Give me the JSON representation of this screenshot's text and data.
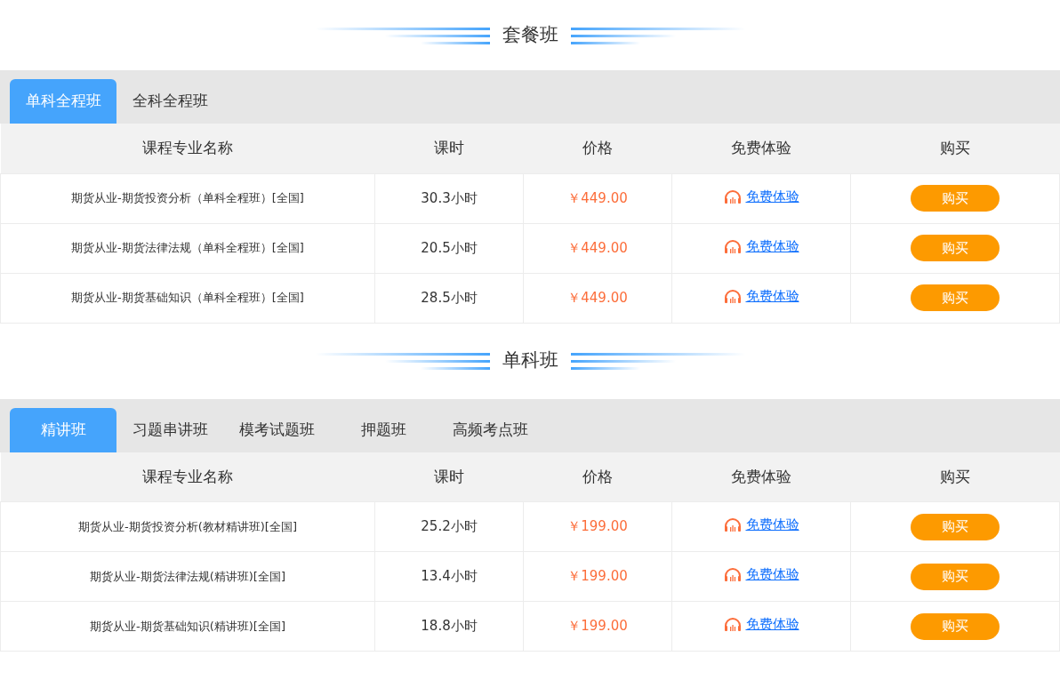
{
  "sections": [
    {
      "title": "套餐班",
      "tabs": [
        {
          "label": "单科全程班",
          "selected": true
        },
        {
          "label": "全科全程班",
          "selected": false
        }
      ],
      "columns": [
        "课程专业名称",
        "课时",
        "价格",
        "免费体验",
        "购买"
      ],
      "rows": [
        {
          "name": "期货从业-期货投资分析（单科全程班）[全国]",
          "hours": "30.3小时",
          "price": "￥449.00",
          "trial": "免费体验",
          "buy": "购买"
        },
        {
          "name": "期货从业-期货法律法规（单科全程班）[全国]",
          "hours": "20.5小时",
          "price": "￥449.00",
          "trial": "免费体验",
          "buy": "购买"
        },
        {
          "name": "期货从业-期货基础知识（单科全程班）[全国]",
          "hours": "28.5小时",
          "price": "￥449.00",
          "trial": "免费体验",
          "buy": "购买"
        }
      ]
    },
    {
      "title": "单科班",
      "tabs": [
        {
          "label": "精讲班",
          "selected": true
        },
        {
          "label": "习题串讲班",
          "selected": false
        },
        {
          "label": "模考试题班",
          "selected": false
        },
        {
          "label": "押题班",
          "selected": false
        },
        {
          "label": "高频考点班",
          "selected": false
        }
      ],
      "columns": [
        "课程专业名称",
        "课时",
        "价格",
        "免费体验",
        "购买"
      ],
      "rows": [
        {
          "name": "期货从业-期货投资分析(教材精讲班)[全国]",
          "hours": "25.2小时",
          "price": "￥199.00",
          "trial": "免费体验",
          "buy": "购买"
        },
        {
          "name": "期货从业-期货法律法规(精讲班)[全国]",
          "hours": "13.4小时",
          "price": "￥199.00",
          "trial": "免费体验",
          "buy": "购买"
        },
        {
          "name": "期货从业-期货基础知识(精讲班)[全国]",
          "hours": "18.8小时",
          "price": "￥199.00",
          "trial": "免费体验",
          "buy": "购买"
        }
      ]
    }
  ]
}
